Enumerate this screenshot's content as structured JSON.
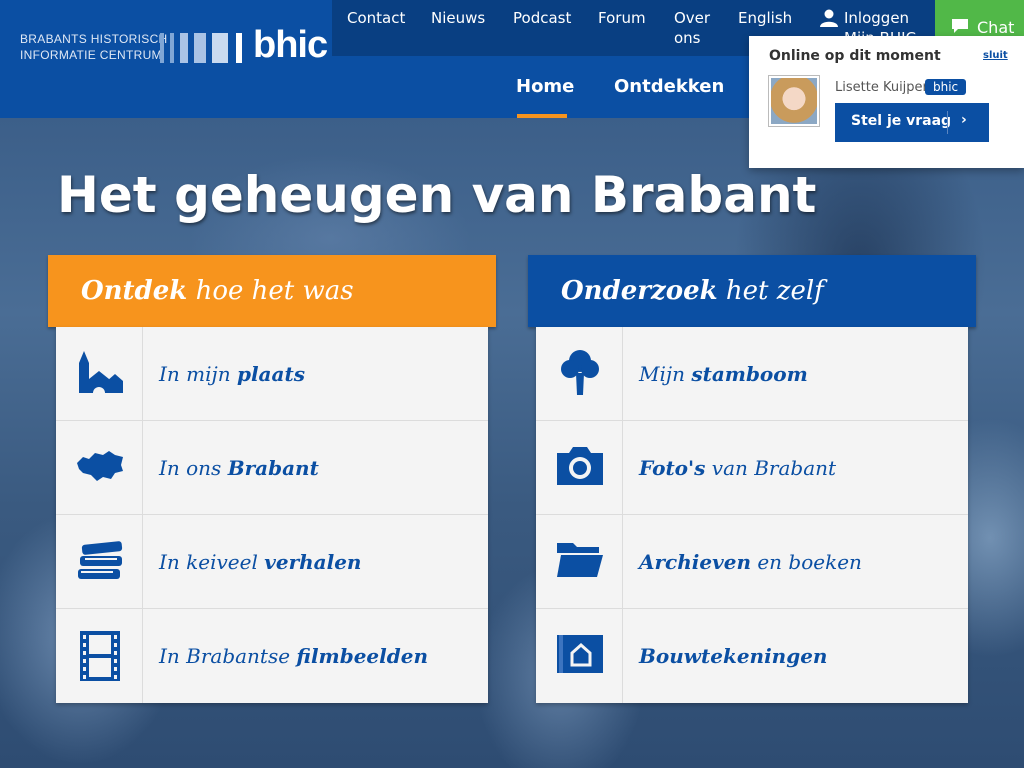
{
  "brand": {
    "line1": "BRABANTS HISTORISCH",
    "line2": "INFORMATIE CENTRUM",
    "word": "bhic"
  },
  "topnav": {
    "items": [
      "Contact",
      "Nieuws",
      "Podcast",
      "Forum",
      "Over ons",
      "English"
    ],
    "login": "Inloggen",
    "login_sub": "Mijn BHIC",
    "chat": "Chat"
  },
  "mainnav": {
    "tabs": [
      "Home",
      "Ontdekken"
    ],
    "active": "Home"
  },
  "hero": {
    "title": "Het geheugen van Brabant"
  },
  "left_panel": {
    "head_bold": "Ontdek",
    "head_rest": " hoe het was",
    "items": [
      {
        "pre": "In mijn ",
        "bold": "plaats",
        "post": "",
        "icon": "village-icon"
      },
      {
        "pre": "In ons ",
        "bold": "Brabant",
        "post": "",
        "icon": "brabant-map-icon"
      },
      {
        "pre": "In keiveel ",
        "bold": "verhalen",
        "post": "",
        "icon": "books-icon"
      },
      {
        "pre": "In Brabantse ",
        "bold": "filmbeelden",
        "post": "",
        "icon": "film-icon"
      }
    ]
  },
  "right_panel": {
    "head_bold": "Onderzoek",
    "head_rest": " het zelf",
    "items": [
      {
        "pre": "Mijn ",
        "bold": "stamboom",
        "post": "",
        "icon": "tree-icon"
      },
      {
        "pre": "",
        "bold": "Foto's",
        "post": " van Brabant",
        "icon": "camera-icon"
      },
      {
        "pre": "",
        "bold": "Archieven",
        "post": " en boeken",
        "icon": "folder-icon"
      },
      {
        "pre": "",
        "bold": "Bouwtekeningen",
        "post": "",
        "icon": "blueprint-icon"
      }
    ]
  },
  "chat_popup": {
    "title": "Online op dit moment",
    "close": "sluit",
    "agent": "Lisette Kuijper",
    "badge": "bhic",
    "button": "Stel je vraag",
    "chevron": "›"
  },
  "colors": {
    "primary_blue": "#0b4fa3",
    "dark_blue": "#093f82",
    "orange": "#f7941d",
    "green": "#51b848"
  }
}
